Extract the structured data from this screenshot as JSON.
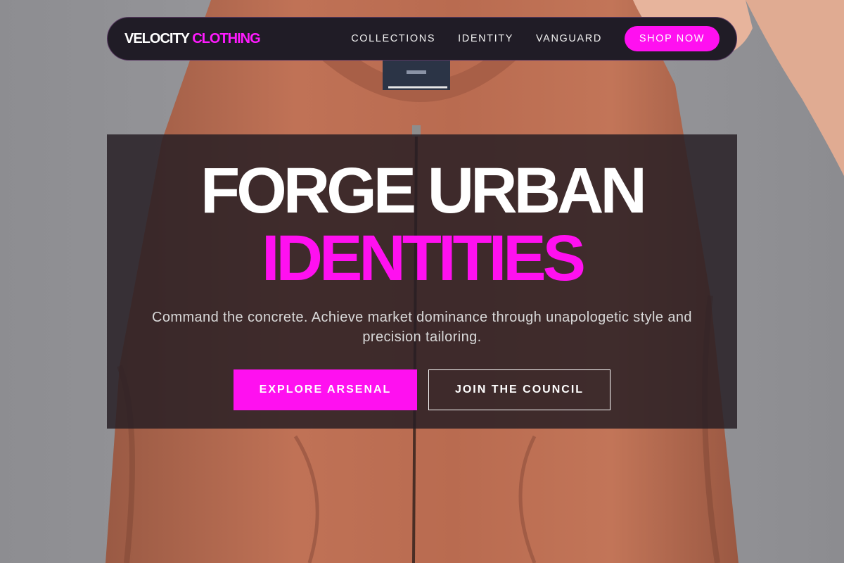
{
  "brand": {
    "name_primary": "VELOCITY",
    "name_accent": "CLOTHING"
  },
  "nav": {
    "links": [
      "COLLECTIONS",
      "IDENTITY",
      "VANGUARD"
    ],
    "cta_label": "SHOP NOW"
  },
  "hero": {
    "headline_line1": "FORGE URBAN",
    "headline_line2": "IDENTITIES",
    "subtitle": "Command the concrete. Achieve market dominance through unapologetic style and precision tailoring.",
    "primary_cta": "EXPLORE ARSENAL",
    "secondary_cta": "JOIN THE COUNCIL",
    "background_image": "orange-bomber-jacket-on-hanger"
  },
  "colors": {
    "accent": "#ff10f0",
    "nav_background": "#201c26",
    "panel_background": "#261e24"
  }
}
